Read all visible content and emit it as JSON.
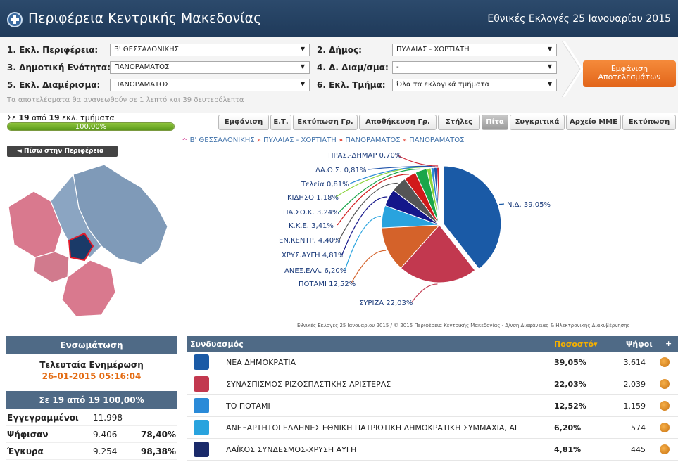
{
  "header": {
    "title": "Περιφέρεια Κεντρικής Μακεδονίας",
    "election": "Εθνικές Εκλογές 25 Ιανουαρίου 2015"
  },
  "filters": {
    "f1_label": "1. Εκλ. Περιφέρεια:",
    "f1_value": "Β' ΘΕΣΣΑΛΟΝΙΚΗΣ",
    "f2_label": "2. Δήμος:",
    "f2_value": "ΠΥΛΑΙΑΣ - ΧΟΡΤΙΑΤΗ",
    "f3_label": "3. Δημοτική Ενότητα:",
    "f3_value": "ΠΑΝΟΡΑΜΑΤΟΣ",
    "f4_label": "4. Δ. Διαμ/σμα:",
    "f4_value": "-",
    "f5_label": "5. Εκλ. Διαμέρισμα:",
    "f5_value": "ΠΑΝΟΡΑΜΑΤΟΣ",
    "f6_label": "6. Εκλ. Τμήμα:",
    "f6_value": "Όλα τα εκλογικά τμήματα",
    "note": "Τα αποτελέσματα θα ανανεωθούν σε 1 λεπτό και 39 δευτερόλεπτα",
    "show_btn_line1": "Εμφάνιση",
    "show_btn_line2": "Αποτελεσμάτων"
  },
  "progress": {
    "pre": "Σε ",
    "a": "19",
    "mid": " από ",
    "b": "19",
    "post": " εκλ. τμήματα",
    "percent_text": "100,00%",
    "fraction": 1.0
  },
  "toolbar": {
    "b1": "Εμφάνιση",
    "b2": "Ε.Τ.",
    "b3": "Εκτύπωση Γρ.",
    "b4": "Αποθήκευση Γρ.",
    "b5": "Στήλες",
    "b6": "Πίτα",
    "b7": "Συγκριτικά",
    "b8": "Αρχείο ΜΜΕ",
    "b9": "Εκτύπωση"
  },
  "back_label": "◄ Πίσω στην Περιφέρεια",
  "breadcrumb": {
    "p1": "Β' ΘΕΣΣΑΛΟΝΙΚΗΣ",
    "p2": "ΠΥΛΑΙΑΣ - ΧΟΡΤΙΑΤΗ",
    "p3": "ΠΑΝΟΡΑΜΑΤΟΣ",
    "p4": "ΠΑΝΟΡΑΜΑΤΟΣ",
    "sep": "»"
  },
  "chart_data": {
    "type": "pie",
    "title": "",
    "series": [
      {
        "label": "Ν.Δ. 39,05%",
        "value": 39.05,
        "color": "#1a5aa6"
      },
      {
        "label": "ΣΥΡΙΖΑ 22,03%",
        "value": 22.03,
        "color": "#c2384f"
      },
      {
        "label": "ΠΟΤΑΜΙ 12,52%",
        "value": 12.52,
        "color": "#d4622a"
      },
      {
        "label": "ΑΝΕΞ.ΕΛΛ. 6,20%",
        "value": 6.2,
        "color": "#29a3de"
      },
      {
        "label": "ΧΡΥΣ.ΑΥΓΗ 4,81%",
        "value": 4.81,
        "color": "#14168a"
      },
      {
        "label": "ΕΝ.ΚΕΝΤΡ. 4,40%",
        "value": 4.4,
        "color": "#555555"
      },
      {
        "label": "Κ.Κ.Ε. 3,41%",
        "value": 3.41,
        "color": "#d11a1a"
      },
      {
        "label": "ΠΑ.ΣΟ.Κ. 3,24%",
        "value": 3.24,
        "color": "#1aa64a"
      },
      {
        "label": "ΚΙΔΗΣΟ 1,18%",
        "value": 1.18,
        "color": "#8ad43a"
      },
      {
        "label": "Τελεία 0,81%",
        "value": 0.81,
        "color": "#2a8ad8"
      },
      {
        "label": "ΛΑ.Ο.Σ. 0,81%",
        "value": 0.81,
        "color": "#2255aa"
      },
      {
        "label": "ΠΡΑΣ.-ΔΗΜΑΡ 0,70%",
        "value": 0.7,
        "color": "#d02a3a"
      }
    ],
    "credit": "Εθνικές Εκλογές 25 Ιανουαρίου 2015 / © 2015 Περιφέρεια Κεντρικής Μακεδονίας - Δ/νση Διαφάνειας & Ηλεκτρονικής Διακυβέρνησης"
  },
  "left_panel": {
    "header": "Ενσωμάτωση",
    "update_title": "Τελευταία Ενημέρωση",
    "update_time": "26-01-2015 05:16:04",
    "count_text": "Σε 19 από 19   100,00%",
    "rows": [
      {
        "k": "Εγγεγραμμένοι",
        "v": "11.998",
        "p": ""
      },
      {
        "k": "Ψήφισαν",
        "v": "9.406",
        "p": "78,40%"
      },
      {
        "k": "Έγκυρα",
        "v": "9.254",
        "p": "98,38%"
      }
    ]
  },
  "results": {
    "col_party": "Συνδυασμός",
    "col_pct": "Ποσοστό",
    "col_votes": "Ψήφοι",
    "col_plus": "+",
    "rows": [
      {
        "name": "ΝΕΑ ΔΗΜΟΚΡΑΤΙΑ",
        "pct": "39,05%",
        "votes": "3.614",
        "color": "#1a5aa6"
      },
      {
        "name": "ΣΥΝΑΣΠΙΣΜΟΣ ΡΙΖΟΣΠΑΣΤΙΚΗΣ ΑΡΙΣΤΕΡΑΣ",
        "pct": "22,03%",
        "votes": "2.039",
        "color": "#c2384f"
      },
      {
        "name": "ΤΟ ΠΟΤΑΜΙ",
        "pct": "12,52%",
        "votes": "1.159",
        "color": "#2a8ad8"
      },
      {
        "name": "ΑΝΕΞΑΡΤΗΤΟΙ ΕΛΛΗΝΕΣ ΕΘΝΙΚΗ ΠΑΤΡΙΩΤΙΚΗ ΔΗΜΟΚΡΑΤΙΚΗ ΣΥΜΜΑΧΙΑ, ΑΓ",
        "pct": "6,20%",
        "votes": "574",
        "color": "#29a3de"
      },
      {
        "name": "ΛΑΪΚΟΣ ΣΥΝΔΕΣΜΟΣ-ΧΡΥΣΗ ΑΥΓΗ",
        "pct": "4,81%",
        "votes": "445",
        "color": "#1a2a6a"
      }
    ]
  },
  "colors": {
    "header_bg": "#1f3a5a",
    "accent_orange": "#e2651a",
    "progress_green": "#6aa82a",
    "panel_blue": "#4f6a86"
  }
}
